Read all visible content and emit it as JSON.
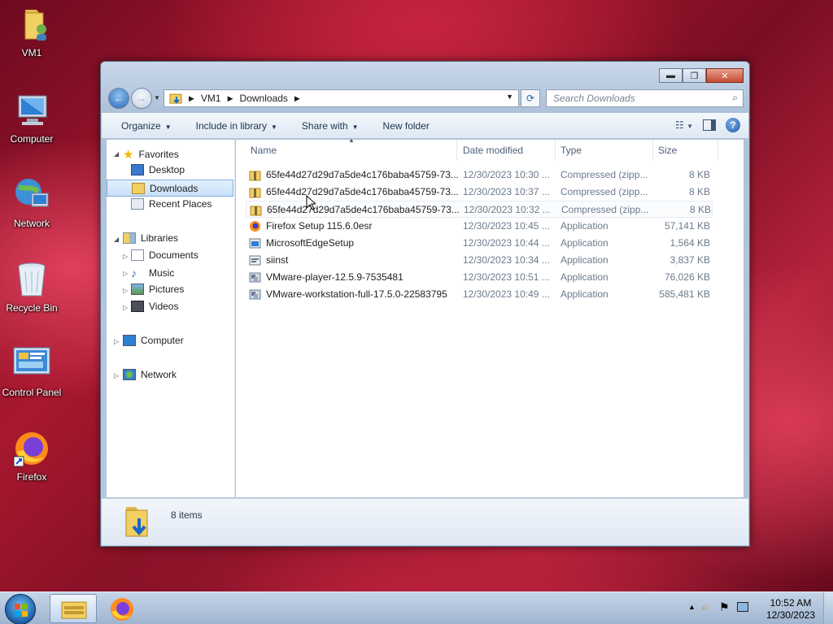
{
  "desktop": {
    "icons": [
      {
        "label": "VM1",
        "icon": "user-folder-icon"
      },
      {
        "label": "Computer",
        "icon": "computer-icon"
      },
      {
        "label": "Network",
        "icon": "network-icon"
      },
      {
        "label": "Recycle Bin",
        "icon": "recycle-bin-icon"
      },
      {
        "label": "Control Panel",
        "icon": "control-panel-icon"
      },
      {
        "label": "Firefox",
        "icon": "firefox-icon"
      }
    ]
  },
  "window": {
    "caption_buttons": {
      "minimize": "▬",
      "maximize": "❐",
      "close": "✕"
    },
    "breadcrumb": [
      "VM1",
      "Downloads"
    ],
    "search_placeholder": "Search Downloads",
    "toolbar": {
      "organize": "Organize",
      "include_in_library": "Include in library",
      "share_with": "Share with",
      "new_folder": "New folder"
    },
    "nav": {
      "favorites": "Favorites",
      "desktop": "Desktop",
      "downloads": "Downloads",
      "recent_places": "Recent Places",
      "libraries": "Libraries",
      "documents": "Documents",
      "music": "Music",
      "pictures": "Pictures",
      "videos": "Videos",
      "computer": "Computer",
      "network": "Network"
    },
    "columns": {
      "name": "Name",
      "date": "Date modified",
      "type": "Type",
      "size": "Size"
    },
    "files": [
      {
        "name": "65fe44d27d29d7a5de4c176baba45759-73...",
        "date": "12/30/2023 10:30 ...",
        "type": "Compressed (zipp...",
        "size": "8 KB",
        "icon": "zip-folder-icon"
      },
      {
        "name": "65fe44d27d29d7a5de4c176baba45759-73...",
        "date": "12/30/2023 10:37 ...",
        "type": "Compressed (zipp...",
        "size": "8 KB",
        "icon": "zip-folder-icon"
      },
      {
        "name": "65fe44d27d29d7a5de4c176baba45759-73...",
        "date": "12/30/2023 10:32 ...",
        "type": "Compressed (zipp...",
        "size": "8 KB",
        "icon": "zip-folder-icon"
      },
      {
        "name": "Firefox Setup 115.6.0esr",
        "date": "12/30/2023 10:45 ...",
        "type": "Application",
        "size": "57,141 KB",
        "icon": "firefox-installer-icon"
      },
      {
        "name": "MicrosoftEdgeSetup",
        "date": "12/30/2023 10:44 ...",
        "type": "Application",
        "size": "1,564 KB",
        "icon": "edge-installer-icon"
      },
      {
        "name": "siinst",
        "date": "12/30/2023 10:34 ...",
        "type": "Application",
        "size": "3,837 KB",
        "icon": "installer-icon"
      },
      {
        "name": "VMware-player-12.5.9-7535481",
        "date": "12/30/2023 10:51 ...",
        "type": "Application",
        "size": "76,026 KB",
        "icon": "vmware-installer-icon"
      },
      {
        "name": "VMware-workstation-full-17.5.0-22583795",
        "date": "12/30/2023 10:49 ...",
        "type": "Application",
        "size": "585,481 KB",
        "icon": "vmware-installer-icon"
      }
    ],
    "status": {
      "item_count": "8 items"
    }
  },
  "taskbar": {
    "clock_time": "10:52 AM",
    "clock_date": "12/30/2023",
    "tray_arrow": "▲"
  },
  "colors": {
    "selection": "#cce4f7",
    "accent": "#2b68b8"
  }
}
